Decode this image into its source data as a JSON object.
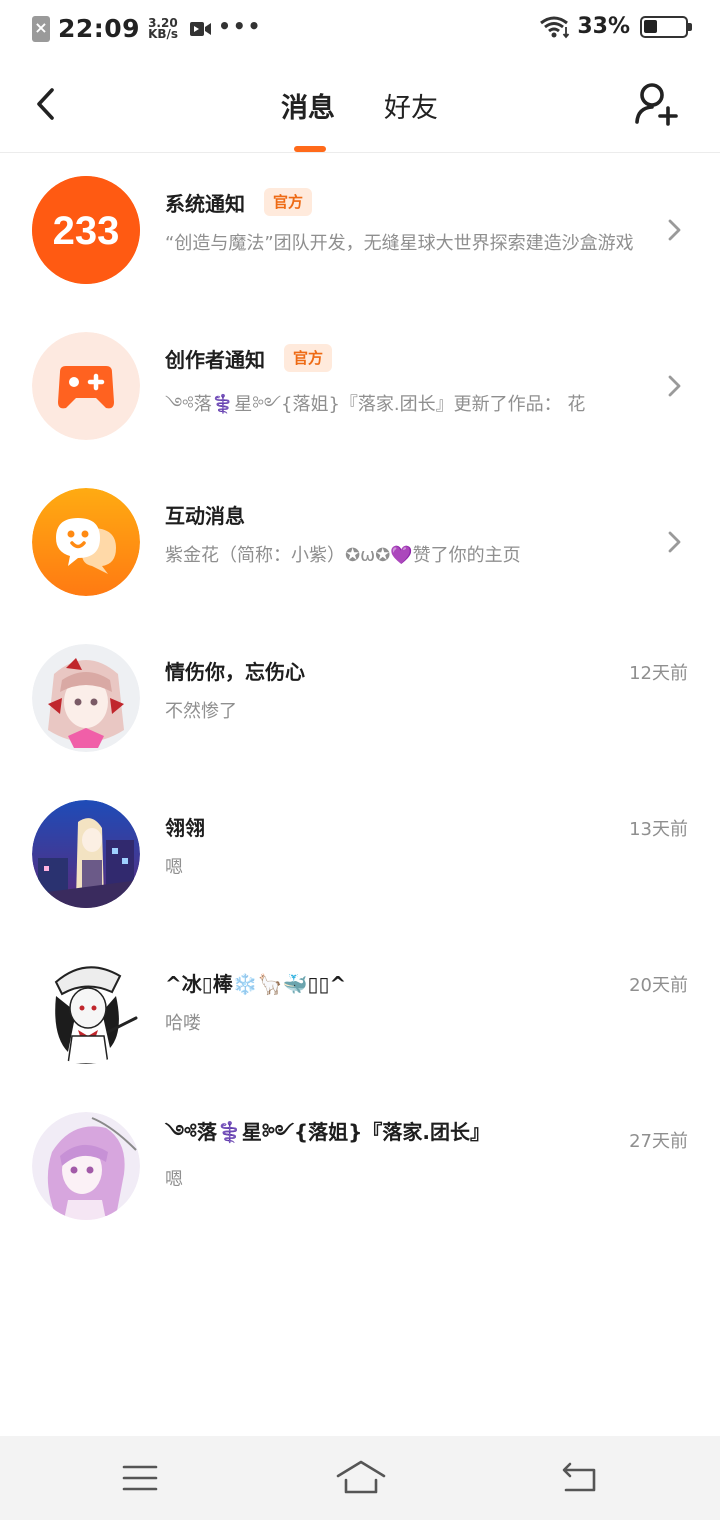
{
  "status_bar": {
    "time": "22:09",
    "speed_value": "3.20",
    "speed_unit": "KB/s",
    "dots": "•••",
    "battery_percent": "33%",
    "battery_level": 0.33
  },
  "header": {
    "tabs": [
      {
        "label": "消息",
        "active": true
      },
      {
        "label": "好友",
        "active": false
      }
    ],
    "accent_color": "#ff6a1a"
  },
  "messages": [
    {
      "title": "系统通知",
      "badge": "官方",
      "preview": "“创造与魔法”团队开发，无缝星球大世界探索建造沙盒游戏",
      "avatar_icon": "233-logo-icon",
      "avatar_text": "233",
      "has_chevron": true
    },
    {
      "title": "创作者通知",
      "badge": "官方",
      "preview": "༺落‍⚕️‍星༻{落姐}『落家.团长』更新了作品： 花",
      "avatar_icon": "gamepad-plus-icon",
      "has_chevron": true
    },
    {
      "title": "互动消息",
      "preview": "紫金花（简称：小紫）✪ω✪💜赞了你的主页",
      "avatar_icon": "chat-bubble-face-icon",
      "has_chevron": true
    },
    {
      "title": "情伤你，忘伤心",
      "preview": "不然惨了",
      "time": "12天前"
    },
    {
      "title": "翎翎",
      "preview": "嗯",
      "time": "13天前"
    },
    {
      "title": "^冰▯棒❄️🦙🐳▯▯^",
      "preview": "哈喽",
      "time": "20天前"
    },
    {
      "title": "༺落‍⚕️‍星༻{落姐}『落家.团长』",
      "preview": "嗯",
      "time": "27天前"
    }
  ],
  "navbar": {
    "items": [
      "menu-icon",
      "home-icon",
      "back-icon"
    ]
  }
}
